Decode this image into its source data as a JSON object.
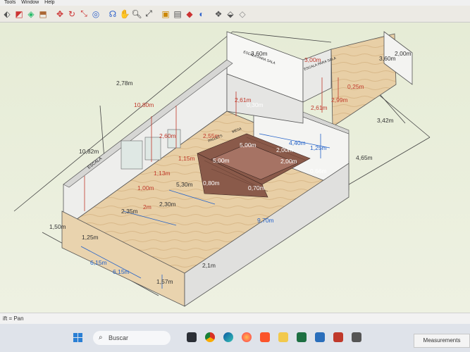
{
  "menu": {
    "tools": "Tools",
    "window": "Window",
    "help": "Help"
  },
  "toolbar_icons": [
    "select-icon",
    "eraser-icon",
    "paint-icon",
    "push-pull-icon",
    "move-icon",
    "rotate-icon",
    "scale-icon",
    "offset-icon",
    "tape-icon",
    "protractor-icon",
    "text-icon",
    "axes-icon",
    "orbit-icon",
    "pan-icon",
    "zoom-icon",
    "zoom-extents-icon",
    "warehouse-icon",
    "component-icon",
    "layer-icon",
    "styles-icon",
    "extension-icon",
    "scene-icon",
    "export-icon"
  ],
  "status": {
    "hint": "ift = Pan"
  },
  "measurements_label": "Measurements",
  "taskbar": {
    "search_placeholder": "Buscar"
  },
  "dimensions": {
    "w360": "3,60m",
    "w300": "3,00m",
    "w200": "2,00m",
    "w360b": "3,60m",
    "w278": "2,78m",
    "w1080": "10,80m",
    "w261": "2,61m",
    "w030": "0,30m",
    "w260": "2,60m",
    "w261b": "2,61m",
    "w299": "2,99m",
    "w025": "0,25m",
    "w342": "3,42m",
    "w465": "4,65m",
    "w1082": "10,82m",
    "w115": "1,15m",
    "w255": "2,55m",
    "w440": "4,40m",
    "w125": "1,25m",
    "w500a": "5,00m",
    "w200b": "2,00m",
    "w066": "0,66m",
    "w500b": "5,00m",
    "w200c": "2,00m",
    "w113": "1,13m",
    "w100": "1,00m",
    "w530": "5,30m",
    "w080": "0,80m",
    "w230": "2,30m",
    "w235": "2,35m",
    "w970": "9,70m",
    "w125b": "1,25m",
    "w615": "6,15m",
    "w615b": "6,15m",
    "w157": "1,57m",
    "w2x": "2,1m",
    "w070": "0,70m",
    "w2": "2m",
    "w150": "1,50m"
  },
  "wall_labels": {
    "back": "ESCALA PARA SALA",
    "right": "ESCALA PARA SALA",
    "left": "ESCALA",
    "center1": "PALLETS",
    "center2": "MESA"
  }
}
